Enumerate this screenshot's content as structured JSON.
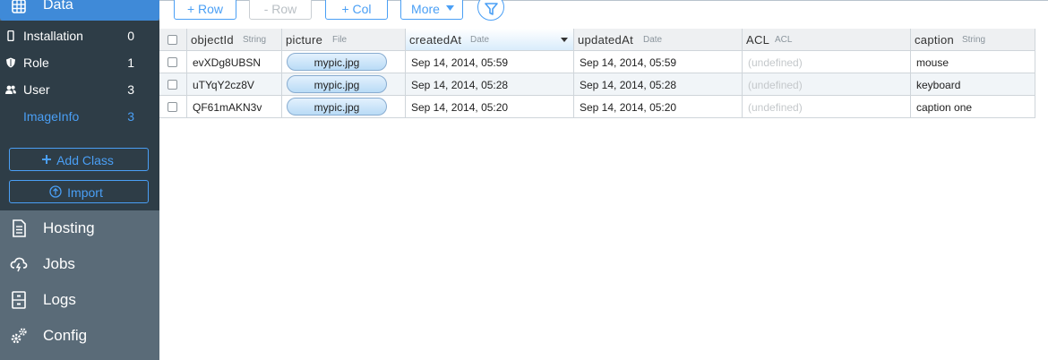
{
  "sidebar": {
    "data_title": "Data",
    "classes": [
      {
        "name": "Installation",
        "count": "0",
        "icon": "phone-icon"
      },
      {
        "name": "Role",
        "count": "1",
        "icon": "shield-icon"
      },
      {
        "name": "User",
        "count": "3",
        "icon": "users-icon"
      },
      {
        "name": "ImageInfo",
        "count": "3",
        "icon": ""
      }
    ],
    "add_class_label": "Add Class",
    "import_label": "Import",
    "nav": [
      {
        "label": "Hosting",
        "icon": "document-icon"
      },
      {
        "label": "Jobs",
        "icon": "cloud-icon"
      },
      {
        "label": "Logs",
        "icon": "cabinet-icon"
      },
      {
        "label": "Config",
        "icon": "gears-icon"
      }
    ]
  },
  "toolbar": {
    "add_row": "+ Row",
    "remove_row": "- Row",
    "add_col": "+ Col",
    "more": "More"
  },
  "table": {
    "columns": [
      {
        "name": "objectId",
        "type": "String"
      },
      {
        "name": "picture",
        "type": "File"
      },
      {
        "name": "createdAt",
        "type": "Date"
      },
      {
        "name": "updatedAt",
        "type": "Date"
      },
      {
        "name": "ACL",
        "type": "ACL"
      },
      {
        "name": "caption",
        "type": "String"
      }
    ],
    "rows": [
      {
        "objectId": "evXDg8UBSN",
        "picture": "mypic.jpg",
        "createdAt": "Sep 14, 2014, 05:59",
        "updatedAt": "Sep 14, 2014, 05:59",
        "acl": "(undefined)",
        "caption": "mouse"
      },
      {
        "objectId": "uTYqY2cz8V",
        "picture": "mypic.jpg",
        "createdAt": "Sep 14, 2014, 05:28",
        "updatedAt": "Sep 14, 2014, 05:28",
        "acl": "(undefined)",
        "caption": "keyboard"
      },
      {
        "objectId": "QF61mAKN3v",
        "picture": "mypic.jpg",
        "createdAt": "Sep 14, 2014, 05:20",
        "updatedAt": "Sep 14, 2014, 05:20",
        "acl": "(undefined)",
        "caption": "caption one"
      }
    ]
  },
  "colors": {
    "accent": "#4a9ff5",
    "sidebar_bg": "#5a6b78",
    "classes_bg": "#2e3d47",
    "data_header": "#3f8ad8"
  }
}
